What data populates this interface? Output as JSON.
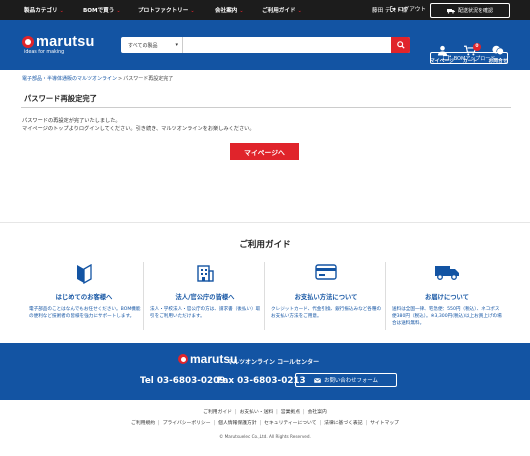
{
  "topnav": {
    "items": [
      {
        "label": "製品カテゴリ"
      },
      {
        "label": "BOMで買う"
      },
      {
        "label": "プロトファクトリー"
      },
      {
        "label": "会社案内"
      },
      {
        "label": "ご利用ガイド"
      }
    ],
    "user": "藤田 テスト様",
    "logout": "ログアウト",
    "delivery": "配送状況を確認"
  },
  "header": {
    "logo_word": "marutsu",
    "logo_tagline": "ideas for making",
    "search_category": "すべての製品",
    "search_placeholder": "",
    "mypage": "マイページ",
    "cart": "カート",
    "cart_count": "0",
    "notice": "お問合せ",
    "bom_upload": "BOMアップロード"
  },
  "breadcrumb": {
    "items": [
      "電子部品・半導体通販のマルツオンライン",
      "パスワード再設定完了"
    ]
  },
  "main": {
    "title": "パスワード再設定完了",
    "message_line1": "パスワードの再設定が完了いたしました。",
    "message_line2": "マイページのトップよりログインしてください。引き続き、マルツオンラインをお楽しみください。",
    "mypage_button": "マイページへ"
  },
  "guide": {
    "title": "ご利用ガイド",
    "columns": [
      {
        "icon": "beginner-icon",
        "heading": "はじめてのお客様へ",
        "desc": "電子部品のことはなんでもお任せください。BOM機能の便利など技術者の皆様を強力にサポートします。"
      },
      {
        "icon": "building-icon",
        "heading": "法人/官公庁の皆様へ",
        "desc": "法人・学校法人・官公庁の方は、請求書（後払い）取引をご利用いただけます。"
      },
      {
        "icon": "payment-card-icon",
        "heading": "お支払い方法について",
        "desc": "クレジットカード、代金引換、銀行振込みなど各種のお支払い方法をご用意。"
      },
      {
        "icon": "truck-icon",
        "heading": "お届けについて",
        "desc": "送料は全国一律、宅急便：550円（税込）、ネコポス便380円（税込）。※3,300円(税込)以上お買上げの場合は送料無料。"
      }
    ]
  },
  "callcenter": {
    "logo_word": "marutsu",
    "center_label": "マルツオンライン コールセンター",
    "tel": "Tel 03-6803-0209",
    "fax": "Fax 03-6803-0213",
    "inquiry_button": "お問い合わせフォーム"
  },
  "footer": {
    "links_row1": [
      "ご利用ガイド",
      "お支払い・送料",
      "営業拠点",
      "会社案内"
    ],
    "links_row2": [
      "ご利用規約",
      "プライバシーポリシー",
      "個人情報保護方針",
      "セキュリティーについて",
      "法律に基づく表記",
      "サイトマップ"
    ],
    "copyright": "© Marutsuelec Co.,Ltd. All Rights Reserved."
  },
  "colors": {
    "brand_blue": "#1354a3",
    "accent_red": "#e0242b",
    "topbar": "#1c1c1c"
  }
}
